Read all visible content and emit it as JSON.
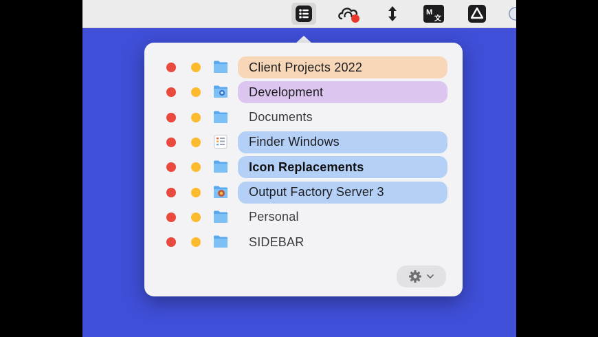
{
  "menubar": {
    "icons": [
      {
        "name": "list-icon",
        "active": true
      },
      {
        "name": "cloud-sync-icon"
      },
      {
        "name": "vertical-arrows-icon"
      },
      {
        "name": "translate-icon"
      },
      {
        "name": "google-drive-icon"
      }
    ]
  },
  "projects": {
    "items": [
      {
        "label": "Client Projects 2022",
        "color": "#f8d7b8",
        "style": "pill",
        "icon": "folder-icon"
      },
      {
        "label": "Development",
        "color": "#dcc5ee",
        "style": "pill",
        "icon": "folder-app-icon"
      },
      {
        "label": "Documents",
        "color": "",
        "style": "plain",
        "icon": "folder-icon"
      },
      {
        "label": "Finder Windows",
        "color": "#b4d0f7",
        "style": "pill",
        "icon": "checklist-icon"
      },
      {
        "label": "Icon Replacements",
        "color": "#b4d0f7",
        "style": "bold-pill",
        "icon": "folder-icon"
      },
      {
        "label": "Output Factory Server 3",
        "color": "#b4d0f7",
        "style": "pill",
        "icon": "folder-badge-icon"
      },
      {
        "label": "Personal",
        "color": "",
        "style": "plain",
        "icon": "folder-icon"
      },
      {
        "label": "SIDEBAR",
        "color": "",
        "style": "plain",
        "icon": "folder-icon"
      }
    ]
  },
  "colors": {
    "desktop": "#3f4fd8",
    "close_dot": "#ea4a3e",
    "minimize_dot": "#fcbb2f",
    "folder_blue": "#5aa9ee"
  },
  "footer": {
    "settings_icon": "gear-icon",
    "menu_icon": "chevron-down-icon"
  }
}
